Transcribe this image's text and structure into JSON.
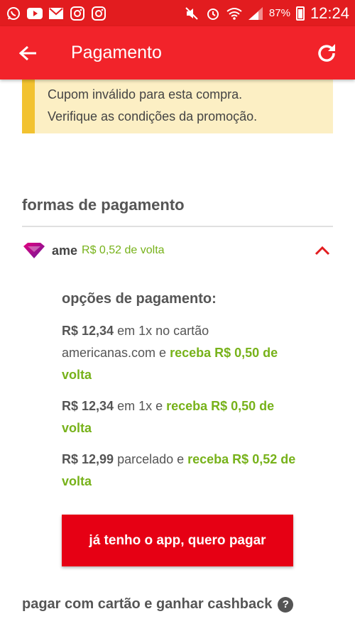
{
  "status_bar": {
    "battery_text": "87%",
    "time": "12:24",
    "left_icons": [
      "whatsapp-icon",
      "youtube-icon",
      "gmail-icon",
      "instagram-icon",
      "instagram-icon"
    ],
    "right_icons": [
      "mute-icon",
      "alarm-icon",
      "wifi-icon",
      "signal-icon",
      "battery-icon"
    ]
  },
  "toolbar": {
    "title": "Pagamento",
    "back_icon": "arrow-left-icon",
    "refresh_icon": "refresh-icon"
  },
  "warning": {
    "line1": "Cupom inválido para esta compra.",
    "line2": "Verifique as condições da promoção."
  },
  "payment_methods": {
    "title": "formas de pagamento",
    "ame": {
      "name": "ame",
      "cashback": "R$ 0,52 de volta",
      "toggle_icon": "chevron-up-icon"
    }
  },
  "options": {
    "title": "opções de pagamento:",
    "items": [
      {
        "price": "R$ 12,34",
        "text": " em 1x no cartão americanas.com e ",
        "green": "receba R$ 0,50 de volta"
      },
      {
        "price": "R$ 12,34",
        "text": " em 1x e ",
        "green": "receba R$ 0,50 de volta"
      },
      {
        "price": "R$ 12,99",
        "text": " parcelado e ",
        "green": "receba R$ 0,52 de volta"
      }
    ],
    "pay_button": "já tenho o app, quero pagar"
  },
  "card_section": {
    "title": "pagar com cartão e ganhar cashback",
    "help_label": "?"
  },
  "colors": {
    "brand_red": "#f2232a",
    "status_red": "#e21c1f",
    "cashback_green": "#77b21a",
    "warning_bg": "#fcefc4",
    "warning_bar": "#f2c230"
  }
}
